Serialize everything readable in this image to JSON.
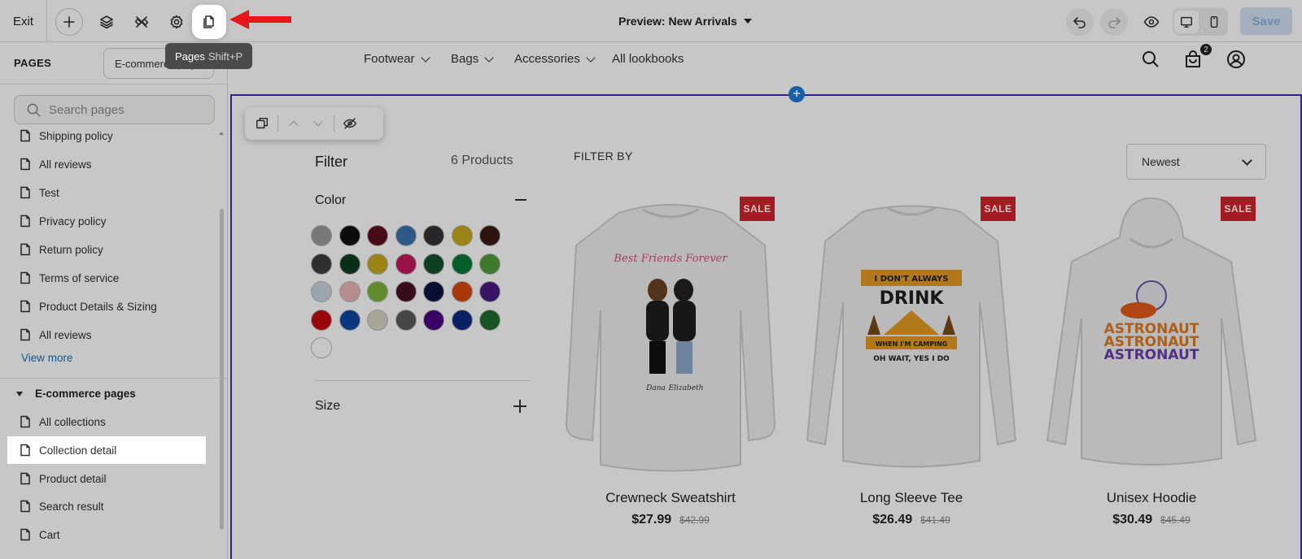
{
  "toolbar": {
    "exit_label": "Exit",
    "preview_title": "Preview: New Arrivals",
    "save_label": "Save",
    "tooltip_label": "Pages",
    "tooltip_shortcut": "Shift+P"
  },
  "sidebar": {
    "title": "PAGES",
    "selector_value": "E-commerce pages",
    "search_placeholder": "Search pages",
    "pages": [
      {
        "label": "Shipping policy"
      },
      {
        "label": "All reviews"
      },
      {
        "label": "Test"
      },
      {
        "label": "Privacy policy"
      },
      {
        "label": "Return policy"
      },
      {
        "label": "Terms of service"
      },
      {
        "label": "Product Details & Sizing"
      },
      {
        "label": "All reviews"
      }
    ],
    "view_more": "View more",
    "group_title": "E-commerce pages",
    "ecommerce_pages": [
      {
        "label": "All collections"
      },
      {
        "label": "Collection detail",
        "selected": true
      },
      {
        "label": "Product detail"
      },
      {
        "label": "Search result"
      },
      {
        "label": "Cart"
      }
    ]
  },
  "store": {
    "nav": [
      "Footwear",
      "Bags",
      "Accessories",
      "All lookbooks"
    ],
    "cart_count": "2",
    "filter_title": "Filter",
    "product_count": "6 Products",
    "color_label": "Color",
    "size_label": "Size",
    "filter_by": "FILTER BY",
    "sort_value": "Newest",
    "swatches": [
      "#9a9a9a",
      "#111111",
      "#5a0f1e",
      "#3a73b0",
      "#333333",
      "#c7a81a",
      "#3a1c12",
      "#3d3d3d",
      "#0f3b1e",
      "#c7a81a",
      "#c2185b",
      "#14502b",
      "#087a36",
      "#4f9d3a",
      "#c7d4e2",
      "#e8b5b8",
      "#7db339",
      "#4a1020",
      "#0a1240",
      "#d9480f",
      "#4a1a80",
      "#c4090f",
      "#0b47a1",
      "#d6d2c4",
      "#5a5a5a",
      "#4b0082",
      "#0d2a80",
      "#1e6b30",
      "#ffffff"
    ],
    "sale_label": "SALE",
    "products": [
      {
        "name": "Crewneck Sweatshirt",
        "price": "$27.99",
        "compare": "$42.99",
        "art_lines": [
          "Best Friends Forever",
          "Dana",
          "Elizabeth"
        ]
      },
      {
        "name": "Long Sleeve Tee",
        "price": "$26.49",
        "compare": "$41.49",
        "art_lines": [
          "I DON'T ALWAYS",
          "DRINK",
          "WHEN I'M CAMPING",
          "OH WAIT, YES I DO"
        ]
      },
      {
        "name": "Unisex Hoodie",
        "price": "$30.49",
        "compare": "$45.49",
        "art_lines": [
          "ASTRONAUT",
          "ASTRONAUT",
          "ASTRONAUT"
        ]
      }
    ]
  },
  "colors": {
    "accent": "#1f7ad8",
    "section_outline": "#3d2fb0",
    "sale_badge": "#d5232d",
    "annotation_arrow": "#e8161b"
  }
}
